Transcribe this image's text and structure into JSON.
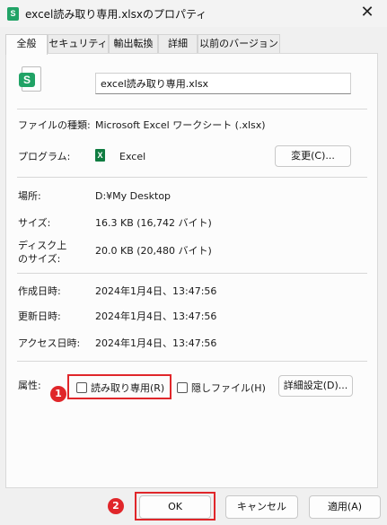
{
  "window": {
    "title": "excel読み取り専用.xlsxのプロパティ",
    "app_icon_letter": "S",
    "close_glyph": "✕"
  },
  "tabs": [
    {
      "label": "全般",
      "active": true
    },
    {
      "label": "セキュリティ",
      "active": false
    },
    {
      "label": "輸出転換",
      "active": false
    },
    {
      "label": "詳細",
      "active": false
    },
    {
      "label": "以前のバージョン",
      "active": false
    }
  ],
  "general": {
    "file_icon_letter": "S",
    "filename": "excel読み取り専用.xlsx",
    "file_type_label": "ファイルの種類:",
    "file_type_value": "Microsoft Excel ワークシート (.xlsx)",
    "program_label": "プログラム:",
    "program_value": "Excel",
    "program_icon_letter": "X",
    "change_button": "変更(C)...",
    "location_label": "場所:",
    "location_value": "D:¥My Desktop",
    "size_label": "サイズ:",
    "size_value": "16.3 KB (16,742 バイト)",
    "disk_size_label_line1": "ディスク上",
    "disk_size_label_line2": "のサイズ:",
    "disk_size_value": "20.0 KB (20,480 バイト)",
    "created_label": "作成日時:",
    "created_value": "2024年1月4日、13:47:56",
    "modified_label": "更新日時:",
    "modified_value": "2024年1月4日、13:47:56",
    "accessed_label": "アクセス日時:",
    "accessed_value": "2024年1月4日、13:47:56",
    "attributes_label": "属性:",
    "readonly_label": "読み取り専用(R)",
    "readonly_checked": false,
    "hidden_label": "隠しファイル(H)",
    "hidden_checked": false,
    "advanced_button": "詳細設定(D)..."
  },
  "annotations": {
    "step1": "1",
    "step2": "2",
    "highlight_color": "#e0262a"
  },
  "buttons": {
    "ok": "OK",
    "cancel": "キャンセル",
    "apply": "適用(A)"
  },
  "colors": {
    "excel_green": "#21a366",
    "accent_red": "#e0262a"
  }
}
